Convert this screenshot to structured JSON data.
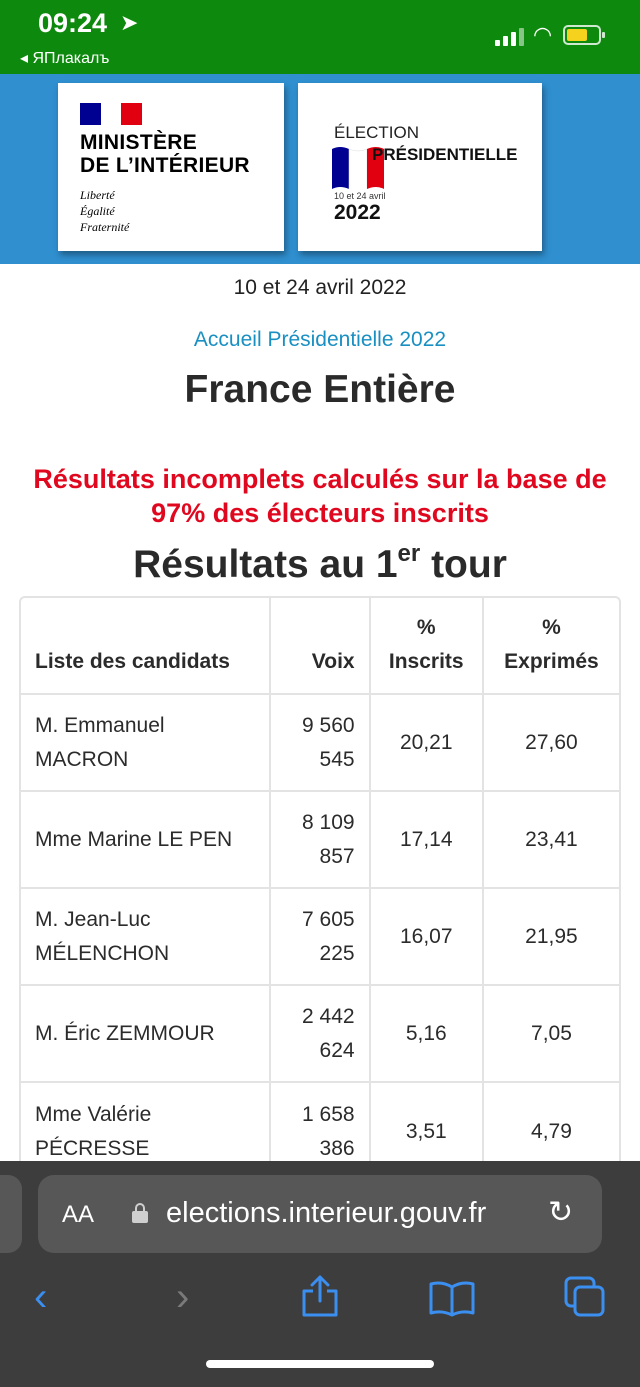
{
  "status_bar": {
    "time": "09:24",
    "back_app": "◂ ЯПлакалъ"
  },
  "header": {
    "ministry_line1": "MINISTÈRE",
    "ministry_line2": "DE L’INTÉRIEUR",
    "motto_1": "Liberté",
    "motto_2": "Égalité",
    "motto_3": "Fraternité",
    "election_line1": "ÉLECTION",
    "election_line2": "PRÉSIDENTIELLE",
    "election_dates": "10 et 24 avril",
    "election_year": "2022",
    "colors": {
      "banner": "#2f8fcf",
      "blue": "#000091",
      "red": "#e1000f"
    }
  },
  "page": {
    "dates": "10 et 24 avril 2022",
    "home_link": "Accueil Présidentielle 2022",
    "region": "France Entière",
    "warning": "Résultats incomplets calculés sur la base de 97% des électeurs inscrits",
    "round_prefix": "Résultats au 1",
    "round_sup": "er",
    "round_suffix": " tour"
  },
  "table": {
    "headers": {
      "candidates": "Liste des candidats",
      "votes": "Voix",
      "pct_registered_1": "%",
      "pct_registered_2": "Inscrits",
      "pct_cast_1": "%",
      "pct_cast_2": "Exprimés"
    },
    "rows": [
      {
        "name": "M. Emmanuel MACRON",
        "votes": "9 560 545",
        "registered": "20,21",
        "cast": "27,60"
      },
      {
        "name": "Mme Marine LE PEN",
        "votes": "8 109 857",
        "registered": "17,14",
        "cast": "23,41"
      },
      {
        "name": "M. Jean-Luc MÉLENCHON",
        "votes": "7 605 225",
        "registered": "16,07",
        "cast": "21,95"
      },
      {
        "name": "M. Éric ZEMMOUR",
        "votes": "2 442 624",
        "registered": "5,16",
        "cast": "7,05"
      },
      {
        "name": "Mme Valérie PÉCRESSE",
        "votes": "1 658 386",
        "registered": "3,51",
        "cast": "4,79"
      }
    ]
  },
  "browser": {
    "aa_label": "AA",
    "url": "elections.interieur.gouv.fr",
    "toolbar_icons": [
      "back-icon",
      "forward-icon",
      "share-icon",
      "bookmarks-icon",
      "tabs-icon"
    ]
  }
}
